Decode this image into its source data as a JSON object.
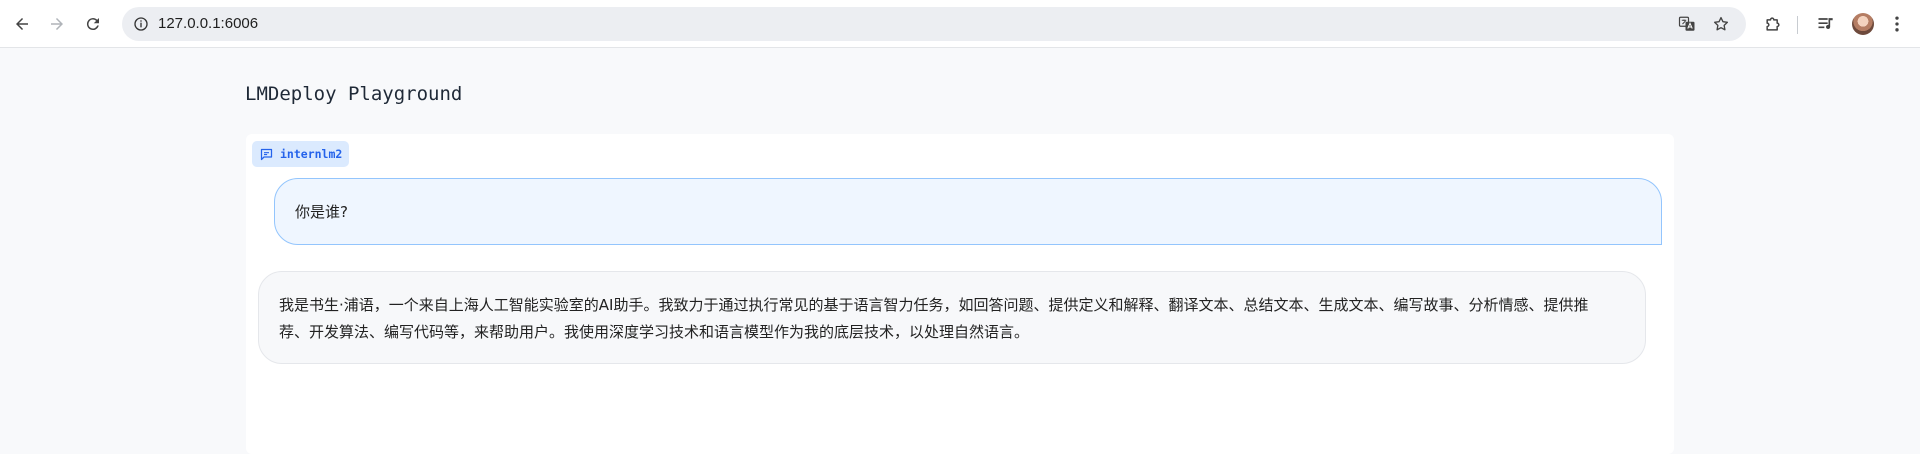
{
  "browser": {
    "url": "127.0.0.1:6006",
    "icons": {
      "back": "arrow-left-icon",
      "forward": "arrow-right-icon",
      "reload": "reload-icon",
      "site_info": "info-icon",
      "translate": "translate-icon",
      "bookmark": "star-icon",
      "extensions": "puzzle-icon",
      "media": "media-queue-icon",
      "menu": "kebab-menu-icon"
    }
  },
  "app": {
    "title": "LMDeploy Playground"
  },
  "chat": {
    "model_badge": "internlm2",
    "messages": [
      {
        "role": "user",
        "text": "你是谁?"
      },
      {
        "role": "assistant",
        "text": "我是书生·浦语，一个来自上海人工智能实验室的AI助手。我致力于通过执行常见的基于语言智力任务，如回答问题、提供定义和解释、翻译文本、总结文本、生成文本、编写故事、分析情感、提供推荐、开发算法、编写代码等，来帮助用户。我使用深度学习技术和语言模型作为我的底层技术，以处理自然语言。"
      }
    ]
  },
  "colors": {
    "accent": "#2563eb",
    "badge_bg": "#dbeafe",
    "user_bubble_bg": "#eff6ff",
    "user_bubble_border": "#93c5fd",
    "bot_bubble_bg": "#f7f8fa"
  }
}
